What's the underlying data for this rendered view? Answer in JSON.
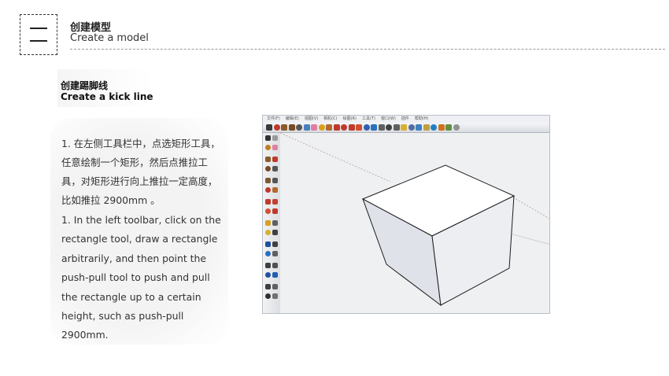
{
  "header": {
    "title_cn": "创建模型",
    "title_en": "Create a model"
  },
  "section": {
    "title_cn": "创建踢脚线",
    "title_en": "Create a kick line"
  },
  "instructions": {
    "cn": "1. 在左侧工具栏中，点选矩形工具，任意绘制一个矩形，然后点推拉工具，对矩形进行向上推拉一定高度，比如推拉 2900mm 。",
    "en": "1. In the left toolbar, click on the rectangle tool, draw a rectangle arbitrarily, and then point the push-pull tool to push and pull the rectangle up to a certain height, such as push-pull 2900mm."
  },
  "app": {
    "menu_items": [
      "文件(F)",
      "编辑(E)",
      "视图(V)",
      "相机(C)",
      "绘图(R)",
      "工具(T)",
      "窗口(W)",
      "插件",
      "帮助(H)"
    ],
    "toolbar_icons": [
      {
        "name": "select-icon",
        "color": "#3a3a3a"
      },
      {
        "name": "line-icon",
        "color": "#c0392b"
      },
      {
        "name": "rectangle-icon",
        "color": "#8b5a2b"
      },
      {
        "name": "circle-icon",
        "color": "#7a4a22"
      },
      {
        "name": "arc-icon",
        "color": "#555555"
      },
      {
        "name": "polygon-icon",
        "color": "#4a7fc0"
      },
      {
        "name": "eraser-icon",
        "color": "#e080a0"
      },
      {
        "name": "paint-bucket-icon",
        "color": "#d8a020"
      },
      {
        "name": "push-pull-icon",
        "color": "#b06a30"
      },
      {
        "name": "offset-icon",
        "color": "#c0392b"
      },
      {
        "name": "move-icon",
        "color": "#c0392b"
      },
      {
        "name": "rotate-icon",
        "color": "#c0392b"
      },
      {
        "name": "scale-icon",
        "color": "#d05030"
      },
      {
        "name": "follow-me-icon",
        "color": "#3060b0"
      },
      {
        "name": "orbit-icon",
        "color": "#2a70c0"
      },
      {
        "name": "pan-icon",
        "color": "#606060"
      },
      {
        "name": "zoom-icon",
        "color": "#404040"
      },
      {
        "name": "zoom-extents-icon",
        "color": "#606060"
      },
      {
        "name": "tape-measure-icon",
        "color": "#d8b030"
      },
      {
        "name": "protractor-icon",
        "color": "#5070a0"
      },
      {
        "name": "components-icon",
        "color": "#4080c0"
      },
      {
        "name": "materials-icon",
        "color": "#c0a040"
      },
      {
        "name": "shadow-icon",
        "color": "#2080c0"
      },
      {
        "name": "section-icon",
        "color": "#d07020"
      },
      {
        "name": "warehouse-icon",
        "color": "#609040"
      },
      {
        "name": "styles-icon",
        "color": "#909090"
      }
    ],
    "sidebar_icons": [
      {
        "name": "select-icon",
        "color": "#333333"
      },
      {
        "name": "component-icon",
        "color": "#9a9a9a"
      },
      {
        "name": "paint-bucket-icon",
        "color": "#c08020"
      },
      {
        "name": "eraser-icon",
        "color": "#e080a0"
      },
      {
        "name": "rectangle-icon",
        "color": "#8b5a2b"
      },
      {
        "name": "line-icon",
        "color": "#c0392b"
      },
      {
        "name": "circle-icon",
        "color": "#7a4a22"
      },
      {
        "name": "arc-icon",
        "color": "#555555"
      },
      {
        "name": "polygon-icon",
        "color": "#7a5a30"
      },
      {
        "name": "freehand-icon",
        "color": "#555555"
      },
      {
        "name": "move-icon",
        "color": "#c0392b"
      },
      {
        "name": "push-pull-icon",
        "color": "#b06a30"
      },
      {
        "name": "rotate-icon",
        "color": "#c0392b"
      },
      {
        "name": "follow-me-icon",
        "color": "#c04030"
      },
      {
        "name": "scale-icon",
        "color": "#d05030"
      },
      {
        "name": "offset-icon",
        "color": "#c0392b"
      },
      {
        "name": "tape-measure-icon",
        "color": "#d8a020"
      },
      {
        "name": "dimension-icon",
        "color": "#606060"
      },
      {
        "name": "protractor-icon",
        "color": "#d8b030"
      },
      {
        "name": "text-icon",
        "color": "#404040"
      },
      {
        "name": "axes-icon",
        "color": "#2050a0"
      },
      {
        "name": "3d-text-icon",
        "color": "#404040"
      },
      {
        "name": "orbit-icon",
        "color": "#2a70c0"
      },
      {
        "name": "pan-icon",
        "color": "#606060"
      },
      {
        "name": "zoom-icon",
        "color": "#404040"
      },
      {
        "name": "zoom-window-icon",
        "color": "#505050"
      },
      {
        "name": "zoom-extents-icon",
        "color": "#2050a0"
      },
      {
        "name": "previous-icon",
        "color": "#2060b0"
      },
      {
        "name": "position-camera-icon",
        "color": "#404040"
      },
      {
        "name": "look-around-icon",
        "color": "#606060"
      },
      {
        "name": "walk-icon",
        "color": "#303030"
      },
      {
        "name": "section-plane-icon",
        "color": "#707070"
      }
    ]
  }
}
